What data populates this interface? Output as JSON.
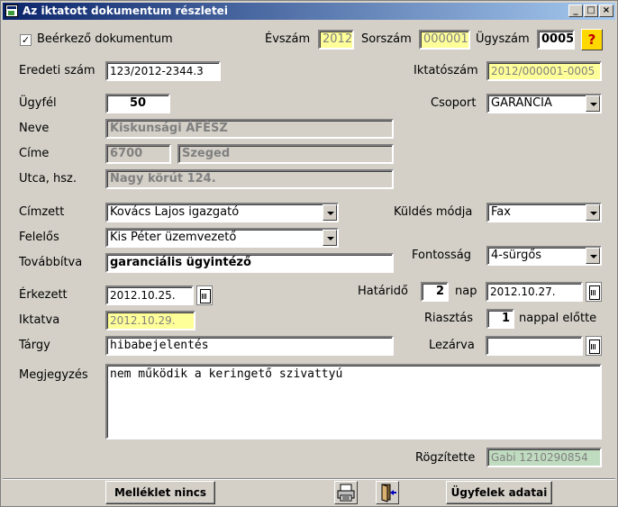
{
  "window": {
    "title": "Az iktatott dokumentum részletei"
  },
  "header": {
    "incoming_label": "Beérkező dokumentum",
    "incoming_checked": true,
    "year_label": "Évszám",
    "year_value": "2012",
    "serial_label": "Sorszám",
    "serial_value": "000001",
    "case_label": "Ügyszám",
    "case_value": "0005",
    "help_icon": "question-mark"
  },
  "form": {
    "original_number_label": "Eredeti szám",
    "original_number_value": "123/2012-2344.3",
    "filing_number_label": "Iktatószám",
    "filing_number_value": "2012/000001-0005",
    "client_label": "Ügyfél",
    "client_value": "50",
    "group_label": "Csoport",
    "group_value": "GARANCIA",
    "name_label": "Neve",
    "name_value": "Kiskunsági ÁFÉSZ",
    "address_label": "Címe",
    "zip_value": "6700",
    "city_value": "Szeged",
    "street_label": "Utca, hsz.",
    "street_value": "Nagy körút 124.",
    "addressee_label": "Címzett",
    "addressee_value": "Kovács Lajos igazgató",
    "send_mode_label": "Küldés módja",
    "send_mode_value": "Fax",
    "responsible_label": "Felelős",
    "responsible_value": "Kis Péter üzemvezető",
    "importance_label": "Fontosság",
    "importance_value": "4-sürgős",
    "forwarded_label": "Továbbítva",
    "forwarded_value": "garanciális ügyintéző",
    "arrived_label": "Érkezett",
    "arrived_value": "2012.10.25.",
    "deadline_label": "Határidő",
    "deadline_days": "2",
    "days_label": "nap",
    "deadline_date": "2012.10.27.",
    "filed_label": "Iktatva",
    "filed_value": "2012.10.29.",
    "alarm_label": "Riasztás",
    "alarm_days": "1",
    "alarm_suffix": "nappal előtte",
    "subject_label": "Tárgy",
    "subject_value": "hibabejelentés",
    "closed_label": "Lezárva",
    "closed_value": "",
    "note_label": "Megjegyzés",
    "note_value": "nem működik a keringető szivattyú",
    "recorded_by_label": "Rögzítette",
    "recorded_by_value": "Gabi 1210290854"
  },
  "footer": {
    "attachment_button": "Melléklet nincs",
    "print_icon": "printer-icon",
    "exit_icon": "exit-door-icon",
    "clients_button": "Ügyfelek adatai"
  },
  "colors": {
    "readonly_yellow": "#ffff99",
    "readonly_gray": "#d4d0c8",
    "recorded_green": "#c0dcc0",
    "titlebar": "#0a246a"
  }
}
